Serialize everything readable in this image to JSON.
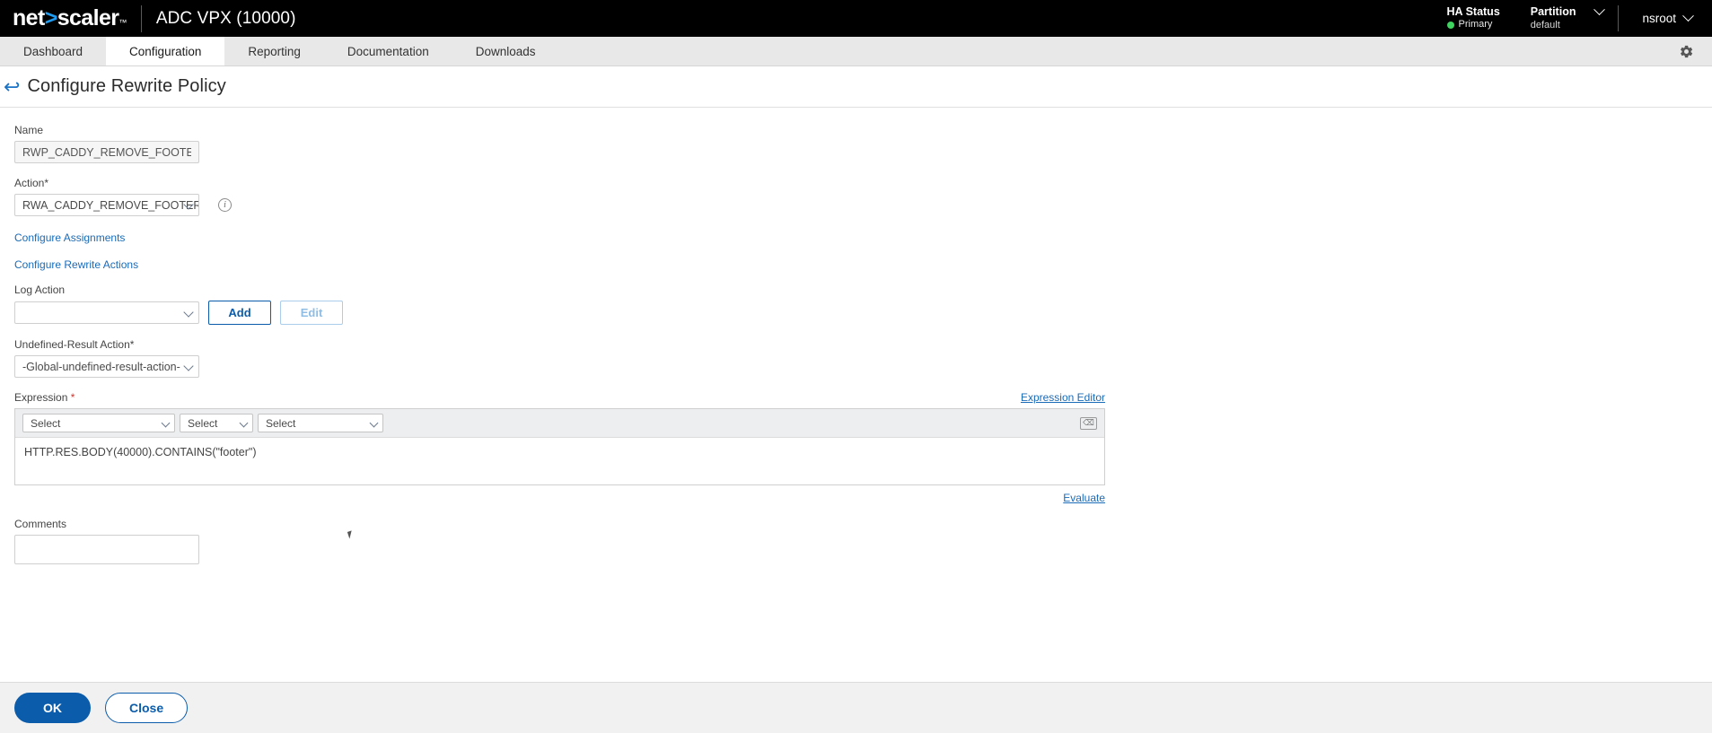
{
  "topbar": {
    "logo_pre": "net",
    "logo_chev": ">",
    "logo_post": "scaler",
    "app_title": "ADC VPX (10000)",
    "ha_label": "HA Status",
    "ha_value": "Primary",
    "ha_color": "#3fd35f",
    "partition_label": "Partition",
    "partition_value": "default",
    "user": "nsroot"
  },
  "nav": {
    "tabs": [
      {
        "label": "Dashboard",
        "active": false
      },
      {
        "label": "Configuration",
        "active": true
      },
      {
        "label": "Reporting",
        "active": false
      },
      {
        "label": "Documentation",
        "active": false
      },
      {
        "label": "Downloads",
        "active": false
      }
    ],
    "gear_icon": "gear-icon"
  },
  "page": {
    "back_icon": "back-arrow-icon",
    "title": "Configure Rewrite Policy"
  },
  "form": {
    "name": {
      "label": "Name",
      "value": "RWP_CADDY_REMOVE_FOOTER"
    },
    "action": {
      "label": "Action",
      "required_mark": "*",
      "value": "RWA_CADDY_REMOVE_FOOTER",
      "info_icon": "info-icon"
    },
    "links": {
      "configure_assignments": "Configure Assignments",
      "configure_rewrite_actions": "Configure Rewrite Actions"
    },
    "log_action": {
      "label": "Log Action",
      "value": "",
      "add_label": "Add",
      "edit_label": "Edit"
    },
    "undefined_result_action": {
      "label": "Undefined-Result Action",
      "required_mark": "*",
      "value": "-Global-undefined-result-action-"
    },
    "expression": {
      "label": "Expression",
      "required_mark": "*",
      "editor_link": "Expression Editor",
      "select_1": "Select",
      "select_2": "Select",
      "select_3": "Select",
      "clear_icon": "clear-backspace-icon",
      "value": "HTTP.RES.BODY(40000).CONTAINS(\"footer\")",
      "evaluate_link": "Evaluate"
    },
    "comments": {
      "label": "Comments",
      "value": ""
    }
  },
  "footer": {
    "ok_label": "OK",
    "close_label": "Close"
  }
}
